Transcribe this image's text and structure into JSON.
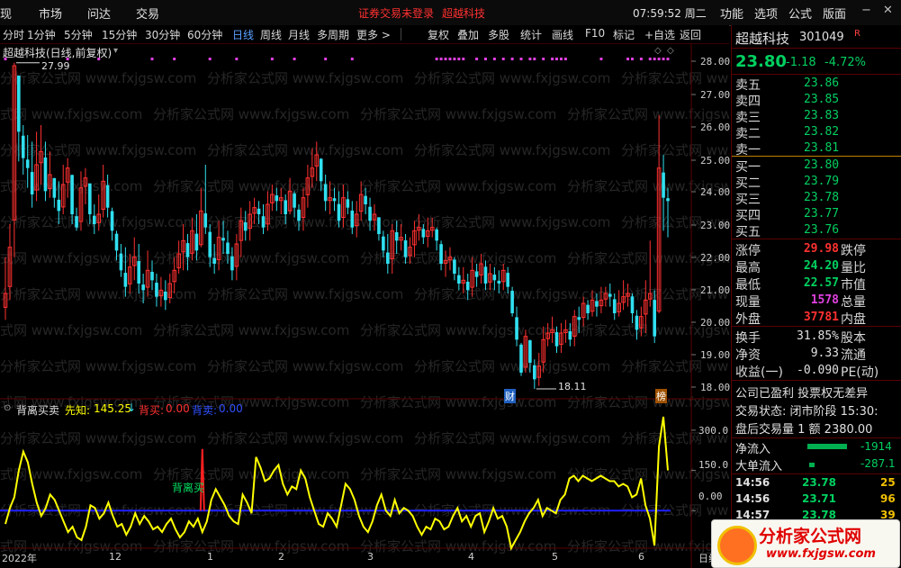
{
  "menubar": {
    "items": [
      "现",
      "市场",
      "问达",
      "交易"
    ],
    "notice": "证券交易未登录",
    "stock_name": "超越科技",
    "clock": "07:59:52 周二",
    "right_menu": [
      "功能",
      "选项",
      "公式",
      "版面"
    ]
  },
  "toolbar": {
    "periods": [
      "分时",
      "1分钟",
      "5分钟",
      "15分钟",
      "30分钟",
      "60分钟",
      "日线",
      "周线",
      "月线",
      "多周期",
      "更多 >"
    ],
    "active_period": "日线",
    "tools": [
      "复权",
      "叠加",
      "多股",
      "统计",
      "画线",
      "F10",
      "标记",
      "+自选",
      "返回"
    ]
  },
  "chart": {
    "title": "超越科技(日线,前复权)",
    "high_label": "27.99",
    "low_label": "18.11",
    "badge_finance": "财",
    "badge_list": "榜",
    "price_axis": [
      "28.00",
      "27.00",
      "26.00",
      "25.00",
      "24.00",
      "23.00",
      "22.00",
      "21.00",
      "20.00",
      "19.00",
      "18.00"
    ],
    "indicator": {
      "name": "背离买卖",
      "xianzhi_label": "先知:",
      "xianzhi_value": "145.25",
      "beimai_label": "背买:",
      "beimai_value": "0.00",
      "beimai2_label": "背卖:",
      "beimai2_value": "0.00",
      "signal_text": "背离买",
      "axis": [
        "300.0",
        "150.0",
        "0.00"
      ]
    },
    "date_axis": [
      "2022年",
      "12",
      "1",
      "2",
      "3",
      "4",
      "5",
      "6"
    ],
    "date_axis_right": "日线",
    "watermark": "分析家公式网 www.fxjgsw.com"
  },
  "chart_data": {
    "type": "candlestick",
    "title": "超越科技(日线,前复权)",
    "ylim": [
      18.0,
      28.2
    ],
    "closes": [
      21.0,
      22.4,
      27.9,
      25.9,
      25.1,
      24.8,
      24.0,
      24.9,
      25.3,
      24.1,
      24.6,
      23.9,
      23.5,
      24.3,
      24.8,
      23.4,
      23.0,
      24.2,
      24.5,
      23.4,
      23.1,
      23.4,
      24.4,
      23.6,
      22.9,
      22.3,
      21.7,
      21.2,
      21.8,
      22.1,
      21.3,
      21.1,
      21.7,
      21.4,
      20.9,
      21.1,
      20.8,
      21.3,
      21.7,
      22.2,
      22.6,
      22.1,
      22.9,
      22.3,
      23.5,
      23.0,
      22.1,
      21.9,
      22.7,
      22.6,
      22.2,
      21.7,
      22.5,
      23.2,
      22.9,
      23.4,
      23.6,
      23.4,
      23.0,
      23.7,
      24.0,
      23.8,
      23.9,
      23.4,
      24.1,
      23.6,
      23.2,
      23.9,
      24.5,
      24.8,
      25.2,
      24.4,
      23.8,
      23.9,
      23.8,
      23.2,
      23.9,
      23.6,
      23.0,
      23.4,
      24.0,
      23.7,
      23.2,
      23.4,
      22.8,
      22.3,
      21.9,
      22.9,
      22.6,
      22.7,
      22.1,
      22.4,
      22.9,
      23.0,
      22.7,
      22.9,
      23.0,
      22.6,
      21.9,
      22.0,
      22.1,
      21.6,
      21.3,
      21.4,
      21.1,
      21.7,
      21.5,
      21.9,
      21.3,
      21.6,
      21.4,
      21.3,
      21.7,
      21.2,
      20.4,
      19.6,
      18.6,
      19.7,
      18.9,
      18.4,
      18.8,
      19.6,
      19.8,
      19.9,
      19.4,
      19.8,
      19.9,
      19.6,
      20.3,
      20.2,
      20.7,
      20.4,
      20.8,
      20.6,
      20.8,
      21.0,
      20.9,
      20.4,
      20.7,
      20.9,
      21.0,
      20.4,
      19.9,
      20.3,
      20.8,
      21.0,
      19.7,
      24.8,
      23.9,
      23.8
    ],
    "highs": [
      22.1,
      23.1,
      27.99,
      27.0,
      26.1,
      25.8,
      25.6,
      25.9,
      26.1,
      25.6,
      25.3,
      24.5,
      24.4,
      24.9,
      25.1,
      24.6,
      23.6,
      24.7,
      24.8,
      24.3,
      23.7,
      24.0,
      24.9,
      24.6,
      23.6,
      22.9,
      22.5,
      22.4,
      22.2,
      22.7,
      22.5,
      21.6,
      22.3,
      22.0,
      21.6,
      21.5,
      21.4,
      21.6,
      22.1,
      22.6,
      23.1,
      22.8,
      23.3,
      23.4,
      24.2,
      24.9,
      23.1,
      22.5,
      23.2,
      23.2,
      22.9,
      22.4,
      22.8,
      23.6,
      23.5,
      23.8,
      23.9,
      23.8,
      23.7,
      24.1,
      24.3,
      24.2,
      24.2,
      24.0,
      24.5,
      24.1,
      23.7,
      24.2,
      24.9,
      25.4,
      25.6,
      25.1,
      24.6,
      24.4,
      24.2,
      24.1,
      24.3,
      24.1,
      23.8,
      23.8,
      24.4,
      24.2,
      23.9,
      23.7,
      23.3,
      22.9,
      22.8,
      23.1,
      23.2,
      23.1,
      22.8,
      22.7,
      23.2,
      23.4,
      23.1,
      23.3,
      23.3,
      23.0,
      22.6,
      22.3,
      22.4,
      22.1,
      21.8,
      21.8,
      21.6,
      22.1,
      21.9,
      22.2,
      22.0,
      21.9,
      21.8,
      21.7,
      21.9,
      21.8,
      21.2,
      20.6,
      19.5,
      19.9,
      19.6,
      19.0,
      19.2,
      20.0,
      20.1,
      20.3,
      20.0,
      20.1,
      20.2,
      20.1,
      20.5,
      20.6,
      20.9,
      20.8,
      21.1,
      21.0,
      21.2,
      21.2,
      21.3,
      21.0,
      21.1,
      21.4,
      21.3,
      21.0,
      20.5,
      20.6,
      21.4,
      22.6,
      21.1,
      26.4,
      25.2,
      24.2
    ],
    "lows": [
      20.2,
      20.8,
      22.1,
      25.0,
      24.6,
      24.2,
      23.6,
      23.8,
      24.3,
      23.8,
      23.9,
      23.6,
      23.1,
      23.4,
      23.9,
      23.1,
      22.9,
      22.9,
      23.7,
      23.1,
      22.8,
      22.9,
      23.3,
      23.3,
      22.6,
      22.0,
      21.5,
      20.9,
      21.0,
      21.4,
      21.0,
      20.7,
      20.9,
      21.1,
      20.6,
      20.6,
      20.5,
      20.7,
      21.0,
      21.6,
      21.7,
      21.7,
      22.0,
      22.0,
      22.4,
      22.8,
      21.8,
      21.6,
      21.7,
      22.2,
      21.9,
      21.4,
      21.4,
      22.1,
      22.6,
      22.6,
      23.1,
      23.1,
      22.8,
      22.9,
      23.5,
      23.5,
      23.4,
      23.1,
      23.4,
      23.3,
      22.9,
      22.9,
      23.6,
      24.2,
      24.4,
      24.1,
      23.5,
      23.4,
      23.5,
      23.0,
      23.0,
      23.4,
      22.8,
      22.7,
      23.2,
      23.4,
      22.9,
      22.9,
      22.6,
      22.1,
      21.6,
      21.6,
      22.2,
      22.3,
      21.9,
      21.9,
      22.1,
      22.6,
      22.5,
      22.4,
      22.7,
      22.3,
      21.7,
      21.5,
      21.7,
      21.4,
      21.1,
      21.0,
      20.8,
      20.9,
      21.2,
      21.3,
      21.1,
      21.1,
      21.1,
      21.0,
      21.1,
      21.0,
      20.3,
      19.4,
      18.5,
      18.6,
      18.6,
      18.11,
      18.2,
      18.6,
      19.4,
      19.5,
      19.2,
      19.2,
      19.5,
      19.4,
      19.4,
      19.8,
      20.0,
      20.2,
      20.3,
      20.3,
      20.4,
      20.6,
      20.6,
      20.2,
      20.3,
      20.5,
      20.6,
      20.1,
      19.6,
      19.7,
      19.8,
      20.6,
      19.5,
      20.4,
      22.9,
      22.7
    ],
    "indicator_series": {
      "name": "背离买卖",
      "ylim": [
        -120,
        350
      ],
      "values": [
        -50,
        10,
        50,
        150,
        220,
        180,
        100,
        30,
        -20,
        10,
        60,
        40,
        0,
        -40,
        -80,
        -60,
        -100,
        -110,
        -60,
        20,
        10,
        -30,
        -10,
        30,
        -20,
        -60,
        -50,
        -90,
        -60,
        -10,
        -50,
        -20,
        -40,
        -70,
        -60,
        -80,
        -50,
        -30,
        -70,
        -100,
        -80,
        -40,
        -60,
        -30,
        -80,
        -40,
        40,
        80,
        50,
        20,
        -20,
        -40,
        -50,
        60,
        30,
        -10,
        200,
        160,
        110,
        120,
        150,
        170,
        100,
        60,
        90,
        80,
        150,
        120,
        50,
        0,
        -50,
        -60,
        -10,
        -30,
        -60,
        20,
        100,
        80,
        40,
        -20,
        -60,
        -80,
        -40,
        20,
        60,
        0,
        -20,
        40,
        -10,
        10,
        0,
        -20,
        -60,
        -90,
        -60,
        -70,
        -30,
        -40,
        -70,
        -60,
        -20,
        10,
        -40,
        -20,
        -60,
        -20,
        -10,
        -80,
        -40,
        10,
        -30,
        -20,
        -60,
        -140,
        -110,
        -80,
        -40,
        -10,
        10,
        40,
        -20,
        10,
        0,
        -10,
        40,
        60,
        120,
        130,
        110,
        130,
        120,
        110,
        120,
        130,
        120,
        110,
        110,
        90,
        100,
        90,
        50,
        60,
        120,
        20,
        -30,
        -130,
        240,
        350,
        150
      ]
    },
    "signal": {
      "text": "背离买",
      "index": 44
    }
  },
  "quote": {
    "name": "超越科技",
    "code": "301049",
    "r_badge": "R",
    "price": "23.80",
    "change": "-1.18",
    "change_pct": "-4.72%",
    "asks": [
      {
        "label": "卖五",
        "price": "23.86"
      },
      {
        "label": "卖四",
        "price": "23.85"
      },
      {
        "label": "卖三",
        "price": "23.83"
      },
      {
        "label": "卖二",
        "price": "23.82"
      },
      {
        "label": "卖一",
        "price": "23.81"
      }
    ],
    "bids": [
      {
        "label": "买一",
        "price": "23.80"
      },
      {
        "label": "买二",
        "price": "23.79"
      },
      {
        "label": "买三",
        "price": "23.78"
      },
      {
        "label": "买四",
        "price": "23.77"
      },
      {
        "label": "买五",
        "price": "23.76"
      }
    ],
    "stats": [
      {
        "label": "涨停",
        "value": "29.98",
        "color": "#ff3030",
        "label2": "跌停"
      },
      {
        "label": "最高",
        "value": "24.20",
        "color": "#00d060",
        "label2": "量比"
      },
      {
        "label": "最低",
        "value": "22.57",
        "color": "#00d060",
        "label2": "市值"
      },
      {
        "label": "现量",
        "value": "1578",
        "color": "#e040e0",
        "label2": "总量"
      },
      {
        "label": "外盘",
        "value": "37781",
        "color": "#ff3030",
        "label2": "内盘"
      }
    ],
    "stats2": [
      {
        "label": "换手",
        "value": "31.85%",
        "label2": "股本"
      },
      {
        "label": "净资",
        "value": "9.33",
        "label2": "流通"
      },
      {
        "label": "收益(一)",
        "value": "-0.090",
        "label2": "PE(动)"
      }
    ],
    "info1": "公司已盈利 投票权无差异",
    "info2": "交易状态: 闭市阶段 15:30:",
    "info3": "盘后交易量 1 额 2380.00",
    "netflow_label": "净流入",
    "netflow_value": "-1914",
    "bigflow_label": "大单流入",
    "bigflow_value": "-287.1",
    "ticks": [
      {
        "time": "14:56",
        "price": "23.78",
        "vol": "25"
      },
      {
        "time": "14:56",
        "price": "23.71",
        "vol": "96"
      },
      {
        "time": "14:57",
        "price": "23.78",
        "vol": "39"
      }
    ],
    "logo_text": "分析家公式网",
    "logo_url": "www.fxjgsw.com"
  },
  "colors": {
    "up": "#ff3030",
    "down": "#30e0f0",
    "green": "#00d060",
    "indicator_line": "#ffff00",
    "zero_line": "#2020ff"
  }
}
